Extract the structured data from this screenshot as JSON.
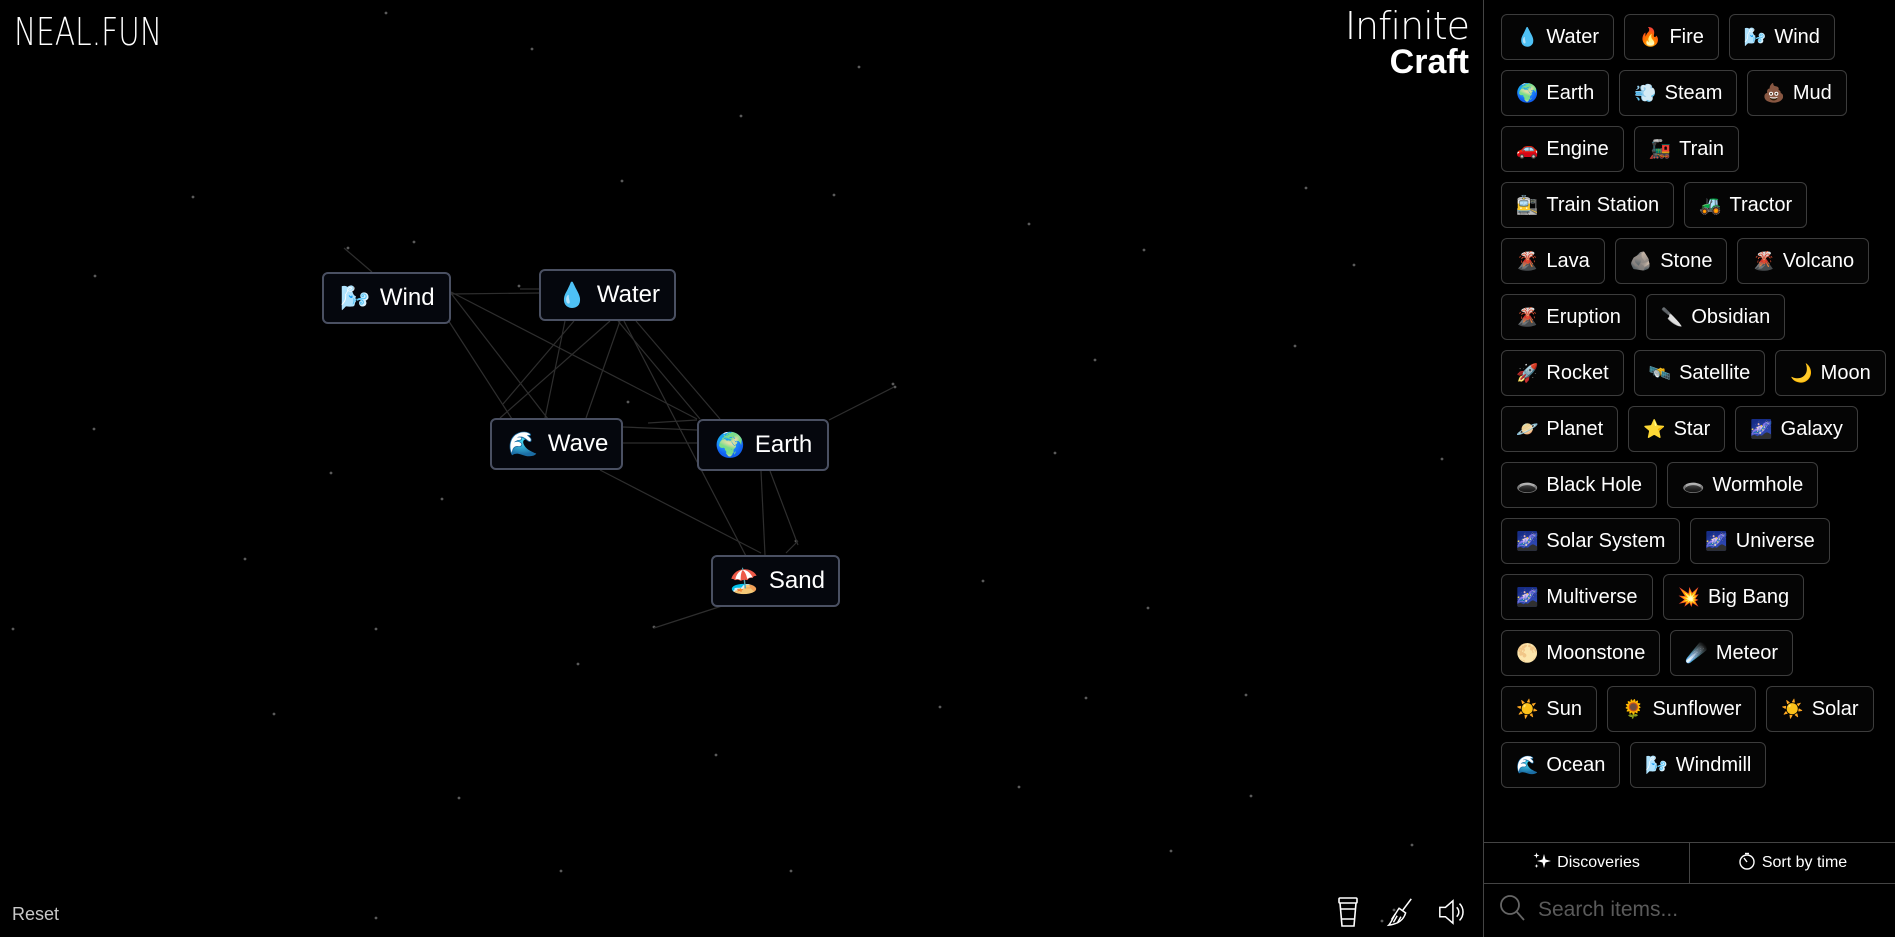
{
  "header": {
    "logo": "NEAL.FUN",
    "title_line1": "Infinite",
    "title_line2": "Craft"
  },
  "canvas": {
    "instances": [
      {
        "label": "Wind",
        "icon": "wind-face-icon",
        "emoji": "🌬️"
      },
      {
        "label": "Water",
        "icon": "water-drop-icon",
        "emoji": "💧"
      },
      {
        "label": "Wave",
        "icon": "wave-icon",
        "emoji": "🌊"
      },
      {
        "label": "Earth",
        "icon": "globe-icon",
        "emoji": "🌍"
      },
      {
        "label": "Sand",
        "icon": "beach-umbrella-icon",
        "emoji": "🏖️"
      }
    ],
    "reset_label": "Reset",
    "tools": [
      {
        "name": "coffee-cup-icon"
      },
      {
        "name": "broom-icon"
      },
      {
        "name": "sound-icon"
      }
    ]
  },
  "sidebar": {
    "items": [
      {
        "label": "Water",
        "emoji": "💧"
      },
      {
        "label": "Fire",
        "emoji": "🔥"
      },
      {
        "label": "Wind",
        "emoji": "🌬️"
      },
      {
        "label": "Earth",
        "emoji": "🌍"
      },
      {
        "label": "Steam",
        "emoji": "💨"
      },
      {
        "label": "Mud",
        "emoji": "💩"
      },
      {
        "label": "Engine",
        "emoji": "🚗"
      },
      {
        "label": "Train",
        "emoji": "🚂"
      },
      {
        "label": "Train Station",
        "emoji": "🚉"
      },
      {
        "label": "Tractor",
        "emoji": "🚜"
      },
      {
        "label": "Lava",
        "emoji": "🌋"
      },
      {
        "label": "Stone",
        "emoji": "🪨"
      },
      {
        "label": "Volcano",
        "emoji": "🌋"
      },
      {
        "label": "Eruption",
        "emoji": "🌋"
      },
      {
        "label": "Obsidian",
        "emoji": "🔪"
      },
      {
        "label": "Rocket",
        "emoji": "🚀"
      },
      {
        "label": "Satellite",
        "emoji": "🛰️"
      },
      {
        "label": "Moon",
        "emoji": "🌙"
      },
      {
        "label": "Planet",
        "emoji": "🪐"
      },
      {
        "label": "Star",
        "emoji": "⭐"
      },
      {
        "label": "Galaxy",
        "emoji": "🌌"
      },
      {
        "label": "Black Hole",
        "emoji": "🕳️"
      },
      {
        "label": "Wormhole",
        "emoji": "🕳️"
      },
      {
        "label": "Solar System",
        "emoji": "🌌"
      },
      {
        "label": "Universe",
        "emoji": "🌌"
      },
      {
        "label": "Multiverse",
        "emoji": "🌌"
      },
      {
        "label": "Big Bang",
        "emoji": "💥"
      },
      {
        "label": "Moonstone",
        "emoji": "🌕"
      },
      {
        "label": "Meteor",
        "emoji": "☄️"
      },
      {
        "label": "Sun",
        "emoji": "☀️"
      },
      {
        "label": "Sunflower",
        "emoji": "🌻"
      },
      {
        "label": "Solar",
        "emoji": "☀️"
      },
      {
        "label": "Ocean",
        "emoji": "🌊"
      },
      {
        "label": "Windmill",
        "emoji": "🌬️"
      }
    ],
    "discoveries_label": "Discoveries",
    "sort_label": "Sort by time",
    "search_placeholder": "Search items..."
  }
}
